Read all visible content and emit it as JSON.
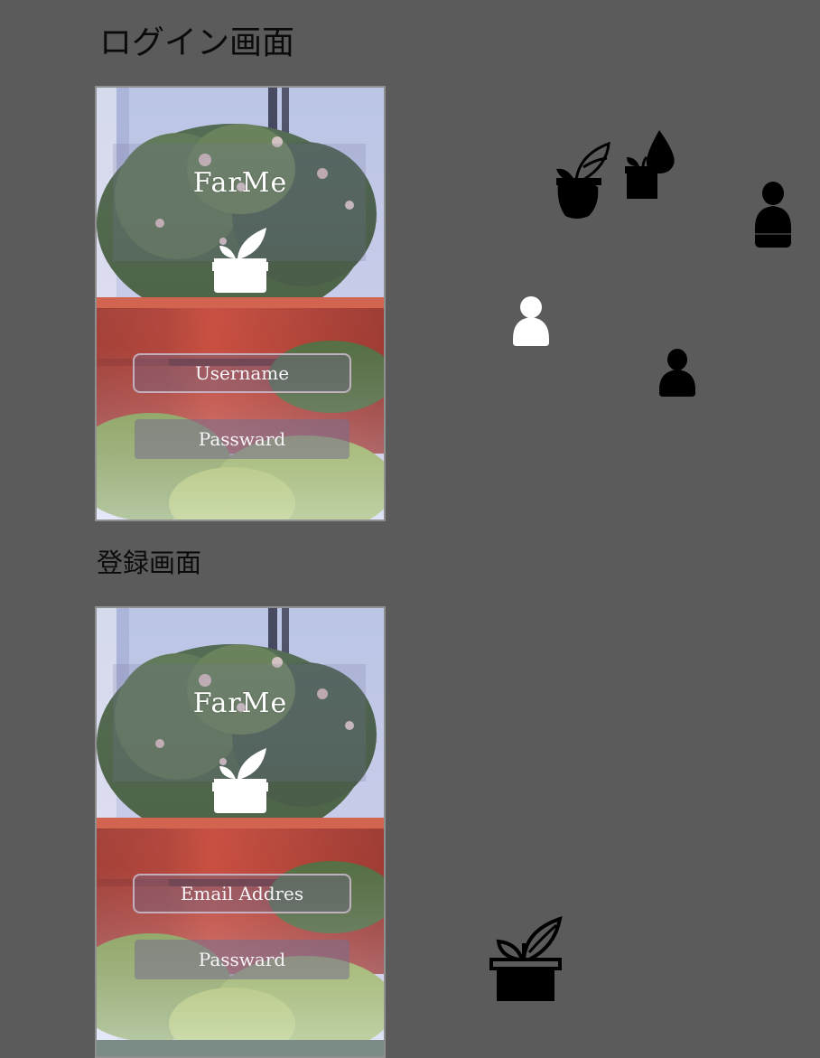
{
  "page": {
    "background": "#5b5b5b"
  },
  "login_section": {
    "title": "ログイン画面",
    "screen": {
      "brand": "FarMe",
      "logo_icon": "potted-plant-icon",
      "username_placeholder": "Username",
      "password_placeholder": "Passward"
    }
  },
  "register_section": {
    "title": "登録画面",
    "screen": {
      "brand": "FarMe",
      "logo_icon": "potted-plant-icon",
      "email_placeholder": "Email  Addres",
      "password_placeholder": "Passward"
    }
  },
  "icon_assets": [
    {
      "name": "plant-pot-filled-icon",
      "color": "#000000"
    },
    {
      "name": "plant-water-drop-icon",
      "color": "#000000"
    },
    {
      "name": "person-tall-icon",
      "color": "#000000"
    },
    {
      "name": "person-white-icon",
      "color": "#ffffff"
    },
    {
      "name": "person-black-icon",
      "color": "#000000"
    },
    {
      "name": "plant-outline-icon",
      "color": "#000000"
    }
  ],
  "colors": {
    "overlay_field": "#6e6482",
    "field_border": "#cdbecd",
    "text_light": "#ffffff",
    "pot_red": "#c8371e",
    "foliage": "#3f5a2a"
  }
}
